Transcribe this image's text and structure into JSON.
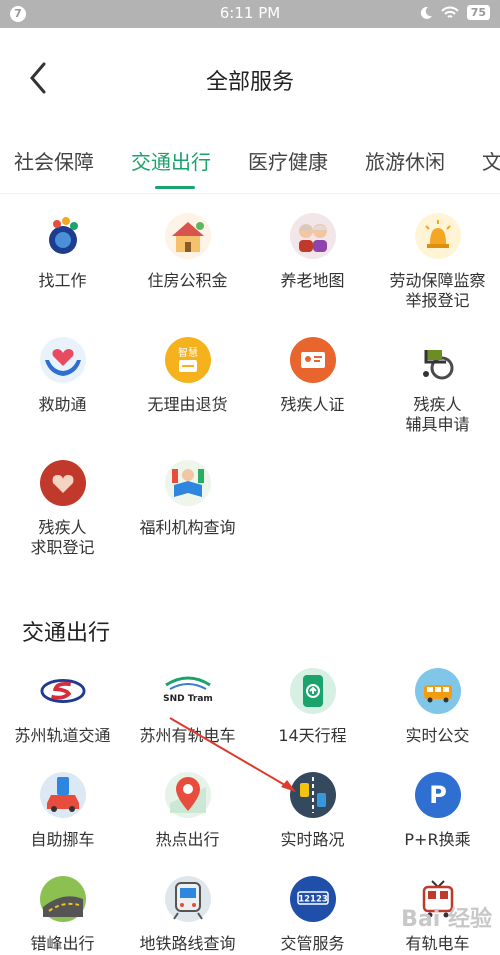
{
  "status_bar": {
    "notification_badge": "7",
    "time": "6:11 PM",
    "battery": "75"
  },
  "header": {
    "title": "全部服务"
  },
  "tabs": [
    {
      "label": "社会保障"
    },
    {
      "label": "交通出行"
    },
    {
      "label": "医疗健康"
    },
    {
      "label": "旅游休闲"
    },
    {
      "label": "文"
    }
  ],
  "social_services": [
    {
      "label": "找工作",
      "icon": "job-icon"
    },
    {
      "label": "住房公积金",
      "icon": "house-icon"
    },
    {
      "label": "养老地图",
      "icon": "elderly-icon"
    },
    {
      "label": "劳动保障监察\n举报登记",
      "icon": "alarm-icon"
    },
    {
      "label": "救助通",
      "icon": "heart-hands-icon"
    },
    {
      "label": "无理由退货",
      "icon": "return-icon",
      "badge": "智慧"
    },
    {
      "label": "残疾人证",
      "icon": "id-card-icon"
    },
    {
      "label": "残疾人\n辅具申请",
      "icon": "wheelchair-icon"
    },
    {
      "label": "残疾人\n求职登记",
      "icon": "hands-heart-icon"
    },
    {
      "label": "福利机构查询",
      "icon": "books-icon"
    }
  ],
  "transport_section": {
    "title": "交通出行",
    "items": [
      {
        "label": "苏州轨道交通",
        "icon": "metro-logo-icon"
      },
      {
        "label": "苏州有轨电车",
        "icon": "tram-logo-icon",
        "logo_text": "SND Tram"
      },
      {
        "label": "14天行程",
        "icon": "itinerary-icon"
      },
      {
        "label": "实时公交",
        "icon": "bus-icon"
      },
      {
        "label": "自助挪车",
        "icon": "move-car-icon"
      },
      {
        "label": "热点出行",
        "icon": "map-pin-icon"
      },
      {
        "label": "实时路况",
        "icon": "traffic-icon"
      },
      {
        "label": "P+R换乘",
        "icon": "parking-icon"
      },
      {
        "label": "错峰出行",
        "icon": "road-icon"
      },
      {
        "label": "地铁路线查询",
        "icon": "subway-icon"
      },
      {
        "label": "交管服务",
        "icon": "traffic-police-icon",
        "badge": "12123"
      },
      {
        "label": "有轨电车",
        "icon": "tram-icon"
      }
    ]
  },
  "watermark": "Bai 经验"
}
